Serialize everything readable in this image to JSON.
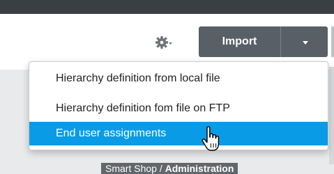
{
  "toolbar": {
    "settings_icon": "gear-icon",
    "import_label": "Import",
    "import_menu_icon": "caret-down-icon"
  },
  "menu": {
    "items": [
      {
        "label": "Hierarchy definition from local file",
        "highlighted": false
      },
      {
        "label": "Hierarchy definition fom file on FTP",
        "highlighted": false
      },
      {
        "label": "End user assignments",
        "highlighted": true
      }
    ]
  },
  "breadcrumb": {
    "root": "Smart Shop",
    "separator": " / ",
    "current": "Administration"
  },
  "cursor": {
    "icon": "hand-pointer-icon"
  },
  "colors": {
    "top_bar": "#3a3f44",
    "button": "#595f66",
    "highlight": "#0a9be6",
    "panel": "#e9eaeb"
  }
}
